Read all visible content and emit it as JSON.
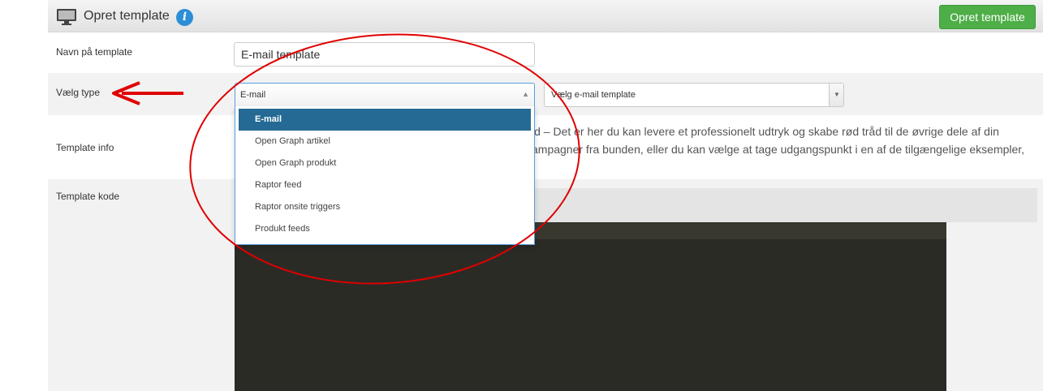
{
  "header": {
    "title": "Opret template",
    "create_button": "Opret template",
    "accent_color": "#4eae48",
    "info_color": "#2c8ed6"
  },
  "form": {
    "name_label": "Navn på template",
    "name_value": "E-mail template",
    "type_label": "Vælg type",
    "type_selected": "E-mail",
    "template_select_placeholder": "Vælg e-mail template",
    "info_label": "Template info",
    "info_line1": "ld – Det er her du kan levere et professionelt udtryk og skabe rød tråd til de øvrige dele af din",
    "info_line2": "ampagner fra bunden, eller du kan vælge at tage udgangspunkt i en af de tilgængelige eksempler,",
    "code_label": "Template kode"
  },
  "dropdown": {
    "options": [
      "E-mail",
      "Open Graph artikel",
      "Open Graph produkt",
      "Raptor feed",
      "Raptor onsite triggers",
      "Produkt feeds"
    ],
    "selected_index": 0,
    "highlight_color": "#246a94"
  },
  "annotation": {
    "color": "#e00000",
    "shapes": [
      "arrow",
      "ellipse"
    ]
  },
  "icons": {
    "header_icon": "monitor-icon",
    "info_icon": "info-icon"
  }
}
